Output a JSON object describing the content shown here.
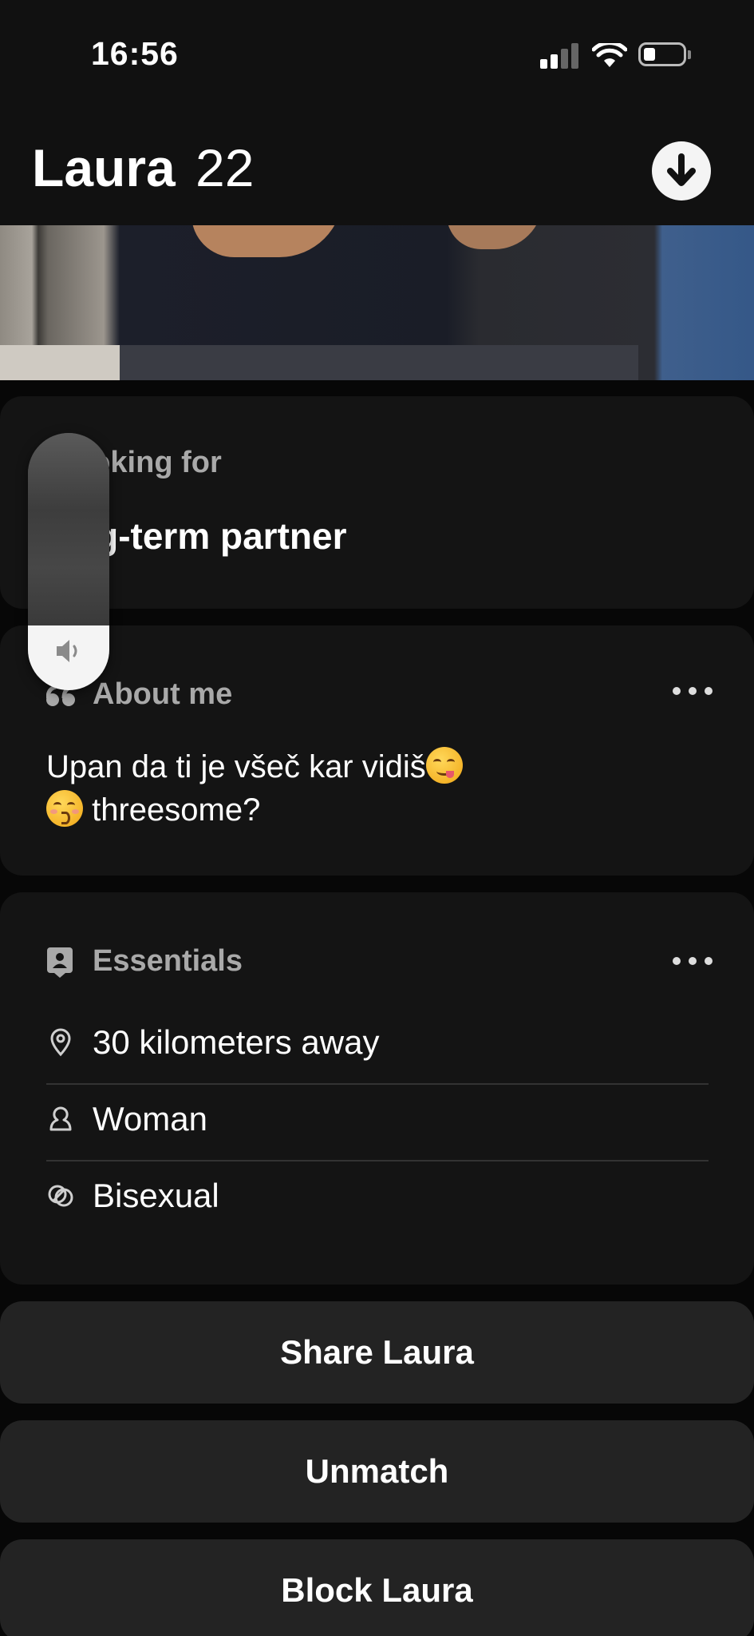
{
  "status_bar": {
    "time": "16:56",
    "icons": [
      "cellular-signal-icon",
      "wifi-icon",
      "battery-icon"
    ]
  },
  "header": {
    "name": "Laura",
    "age": "22",
    "action_icon": "arrow-down-icon"
  },
  "looking_for": {
    "label": "ooking for",
    "value": "ng-term partner"
  },
  "about": {
    "label": "About me",
    "line1": "Upan da ti je všeč kar vidiš",
    "line2": " threesome?",
    "emojis": [
      "savoring-food-emoji",
      "kissing-smiling-eyes-emoji"
    ]
  },
  "essentials": {
    "label": "Essentials",
    "items": [
      {
        "icon": "location-pin-icon",
        "text": "30 kilometers away"
      },
      {
        "icon": "person-icon",
        "text": "Woman"
      },
      {
        "icon": "orientation-icon",
        "text": "Bisexual"
      }
    ]
  },
  "actions": {
    "share": "Share Laura",
    "unmatch": "Unmatch",
    "block": "Block Laura"
  },
  "volume_hud": {
    "icon": "speaker-icon",
    "level": 0.25
  },
  "colors": {
    "background": "#070707",
    "card": "#141414",
    "button": "#232323",
    "muted_text": "#a9a9a9"
  }
}
